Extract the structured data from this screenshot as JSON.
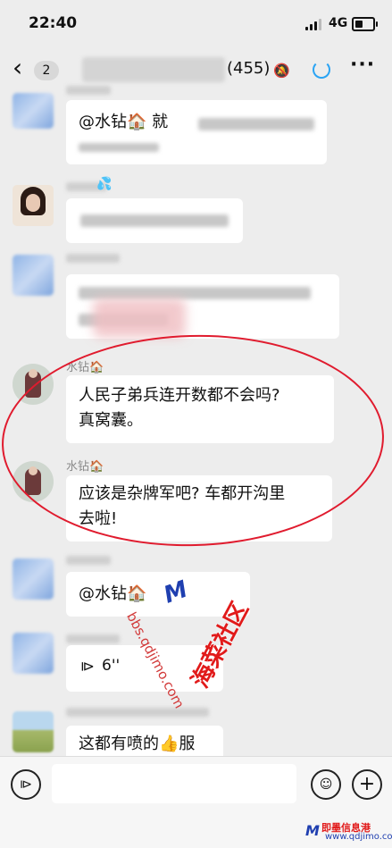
{
  "status_bar": {
    "time": "22:40",
    "network": "4G",
    "icons": [
      "signal-icon",
      "battery-icon"
    ]
  },
  "nav": {
    "back_icon": "chevron-left-icon",
    "unread_count": "2",
    "member_count": "(455)",
    "icons": [
      "mute-bell-icon",
      "ring-icon",
      "more-icon"
    ]
  },
  "messages": [
    {
      "name": "",
      "text": "@水钻🏠 就",
      "avatar": "blurred"
    },
    {
      "name": "",
      "text": "",
      "avatar": "girl"
    },
    {
      "name": "",
      "text": "",
      "avatar": "blurred"
    },
    {
      "name": "水钻🏠",
      "text_line1": "人民子弟兵连开数都不会吗?",
      "text_line2": "真窝囊。",
      "avatar": "shuizuan"
    },
    {
      "name": "水钻🏠",
      "text_line1": "应该是杂牌军吧? 车都开沟里",
      "text_line2": "去啦!",
      "avatar": "shuizuan"
    },
    {
      "name": "",
      "text": "@水钻🏠",
      "avatar": "blurred"
    },
    {
      "name": "",
      "voice_duration": "6''",
      "avatar": "blurred"
    },
    {
      "name": "",
      "text": "这都有喷的👍服",
      "avatar": "field"
    }
  ],
  "watermark": {
    "title": "海菜社区",
    "url": "bbs.qdjimo.com"
  },
  "footer_watermark": {
    "title": "即墨信息港",
    "url": "www.qdjimo.com"
  },
  "input_bar": {
    "icons": [
      "voice-icon",
      "emoji-icon",
      "plus-icon"
    ]
  }
}
